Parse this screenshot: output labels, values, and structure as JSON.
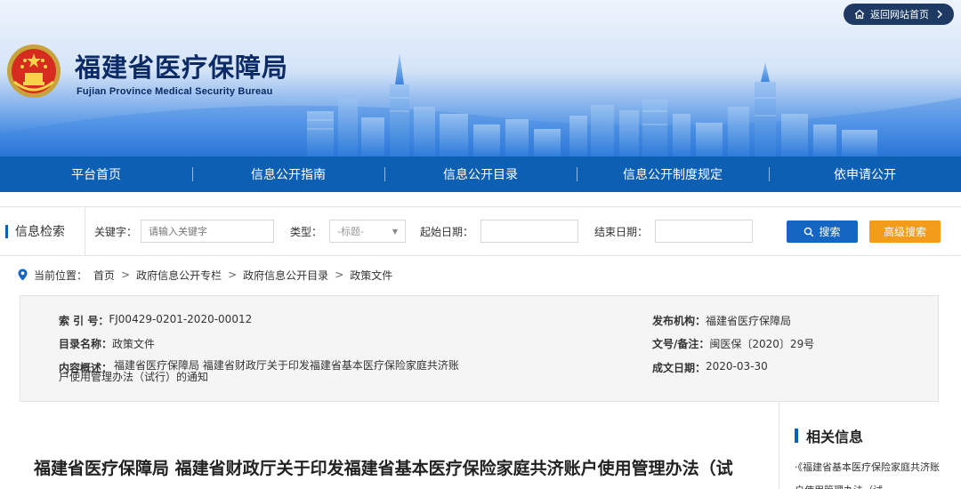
{
  "header": {
    "back_home": "返回网站首页",
    "title_cn": "福建省医疗保障局",
    "title_en": "Fujian Province Medical Security Bureau"
  },
  "nav": {
    "items": [
      "平台首页",
      "信息公开指南",
      "信息公开目录",
      "信息公开制度规定",
      "依申请公开"
    ]
  },
  "search": {
    "title": "信息检索",
    "keyword_label": "关键字：",
    "keyword_placeholder": "请输入关键字",
    "type_label": "类型：",
    "type_value": "-标题-",
    "start_label": "起始日期：",
    "end_label": "结束日期：",
    "search_button": "搜索",
    "advanced_button": "高级搜索"
  },
  "breadcrumb": {
    "prefix": "当前位置：",
    "items": [
      "首页",
      "政府信息公开专栏",
      "政府信息公开目录",
      "政策文件"
    ],
    "separator": ">"
  },
  "meta": {
    "index_label": "索 引 号：",
    "index_value": "FJ00429-0201-2020-00012",
    "publisher_label": "发布机构：",
    "publisher_value": "福建省医疗保障局",
    "category_label": "目录名称：",
    "category_value": "政策文件",
    "doc_no_label": "文号/备注：",
    "doc_no_value": "闽医保〔2020〕29号",
    "summary_label": "内容概述：",
    "summary_value": "福建省医疗保障局 福建省财政厅关于印发福建省基本医疗保险家庭共济账户使用管理办法（试行）的通知",
    "date_label": "成文日期：",
    "date_value": "2020-03-30"
  },
  "article": {
    "title": "福建省医疗保障局 福建省财政厅关于印发福建省基本医疗保险家庭共济账户使用管理办法（试"
  },
  "related": {
    "title": "相关信息",
    "first_item": "·《福建省基本医疗保险家庭共济账户使用管理办法（试"
  },
  "colors": {
    "nav_blue": "#0d5fb4",
    "search_blue": "#1466c2",
    "advanced_orange": "#f39b1a",
    "back_home_bg": "#1e3a63"
  }
}
